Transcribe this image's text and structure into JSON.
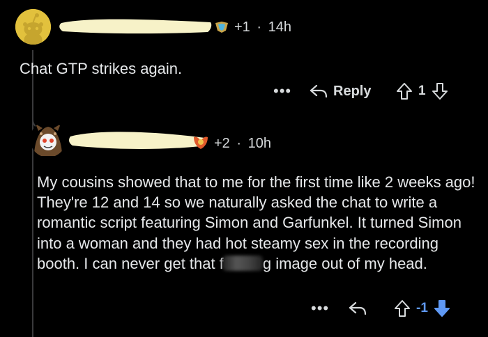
{
  "comment1": {
    "upvote_count_label": "+1",
    "separator": "·",
    "time_ago": "14h",
    "body": "Chat GTP strikes again.",
    "actions": {
      "more_label": "•••",
      "reply_label": "Reply",
      "score": "1"
    }
  },
  "comment2": {
    "upvote_count_label": "+2",
    "separator": "·",
    "time_ago": "10h",
    "body_part1": "My cousins showed that to me for the first time like 2 weeks ago! They're 12 and 14 so we naturally asked the chat to write a romantic script featuring Simon and Garfunkel. It turned Simon into a woman and they had hot steamy sex in the recording booth. I can never get that f",
    "body_part2": "g image out of my head.",
    "actions": {
      "more_label": "•••",
      "score": "-1"
    }
  },
  "colors": {
    "background": "#000000",
    "text": "#d7dadc",
    "downvote_active": "#5f99f5",
    "avatar1_bg": "#e2c13d",
    "thread_line": "#3a3a3c"
  },
  "icons": {
    "reply": "reply-arrow-icon",
    "upvote": "upvote-arrow-icon",
    "downvote": "downvote-arrow-icon",
    "flair": "flair-badge-icon"
  }
}
